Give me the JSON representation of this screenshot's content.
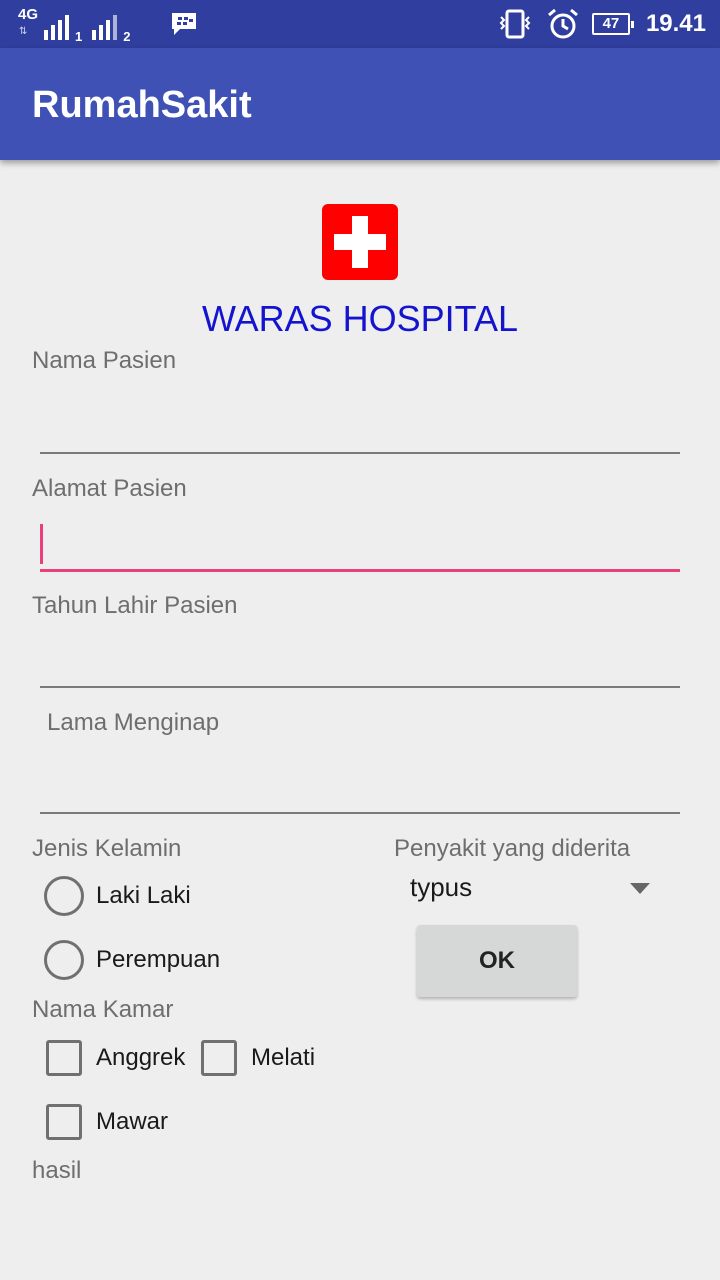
{
  "status_bar": {
    "network": "4G",
    "sim1": "1",
    "sim2": "2",
    "battery": "47",
    "time": "19.41",
    "icons": [
      "signal-icon",
      "bbm-icon",
      "vibrate-icon",
      "alarm-icon",
      "battery-icon"
    ]
  },
  "app_bar": {
    "title": "RumahSakit",
    "color": "#3f51b5"
  },
  "header": {
    "title": "WARAS HOSPITAL",
    "logo": "red-cross-icon"
  },
  "form": {
    "nama_pasien": {
      "label": "Nama Pasien",
      "value": ""
    },
    "alamat_pasien": {
      "label": "Alamat Pasien",
      "value": ""
    },
    "tahun_lahir": {
      "label": "Tahun Lahir Pasien",
      "value": ""
    },
    "lama_menginap": {
      "label": "Lama Menginap",
      "value": ""
    },
    "jenis_kelamin": {
      "label": "Jenis Kelamin",
      "options": [
        "Laki Laki",
        "Perempuan"
      ]
    },
    "penyakit": {
      "label": "Penyakit yang diderita",
      "selected": "typus"
    },
    "ok_button": "OK",
    "nama_kamar": {
      "label": "Nama Kamar",
      "options": [
        "Anggrek",
        "Melati",
        "Mawar"
      ]
    },
    "hasil": "hasil"
  },
  "colors": {
    "accent": "#e8407d",
    "title_blue": "#1414cf",
    "status_bar": "#303f9f"
  }
}
